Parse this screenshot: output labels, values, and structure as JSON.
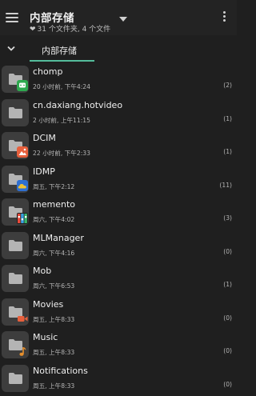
{
  "header": {
    "title": "内部存储",
    "subtitle": "31 个文件夹, 4 个文件"
  },
  "tabs": [
    {
      "label": "内部存储",
      "active": true
    }
  ],
  "accent_color": "#54bc9b",
  "folders": [
    {
      "name": "chomp",
      "date": "20 小时前, 下午4:24",
      "count": "(2)",
      "badge": "chat-icon",
      "badge_color": "#2ea94f"
    },
    {
      "name": "cn.daxiang.hotvideo",
      "date": "2 小时前, 上午11:15",
      "count": "(1)",
      "badge": "",
      "badge_color": ""
    },
    {
      "name": "DCIM",
      "date": "22 小时前, 下午2:33",
      "count": "(1)",
      "badge": "image-icon",
      "badge_color": "#e65f3c"
    },
    {
      "name": "IDMP",
      "date": "周五, 下午2:12",
      "count": "(11)",
      "badge": "cloud-icon",
      "badge_color": "#2f6fd0"
    },
    {
      "name": "memento",
      "date": "周六, 下午4:02",
      "count": "(3)",
      "badge": "multicolor-app-icon",
      "badge_color": "#3aa0e0"
    },
    {
      "name": "MLManager",
      "date": "周六, 下午4:16",
      "count": "(0)",
      "badge": "",
      "badge_color": ""
    },
    {
      "name": "Mob",
      "date": "周六, 下午6:53",
      "count": "(1)",
      "badge": "",
      "badge_color": ""
    },
    {
      "name": "Movies",
      "date": "周五, 上午8:33",
      "count": "(0)",
      "badge": "video-icon",
      "badge_color": "#e65f3c"
    },
    {
      "name": "Music",
      "date": "周五, 上午8:33",
      "count": "(0)",
      "badge": "music-note-icon",
      "badge_color": "#e8902c"
    },
    {
      "name": "Notifications",
      "date": "周五, 上午8:33",
      "count": "(0)",
      "badge": "",
      "badge_color": ""
    }
  ]
}
